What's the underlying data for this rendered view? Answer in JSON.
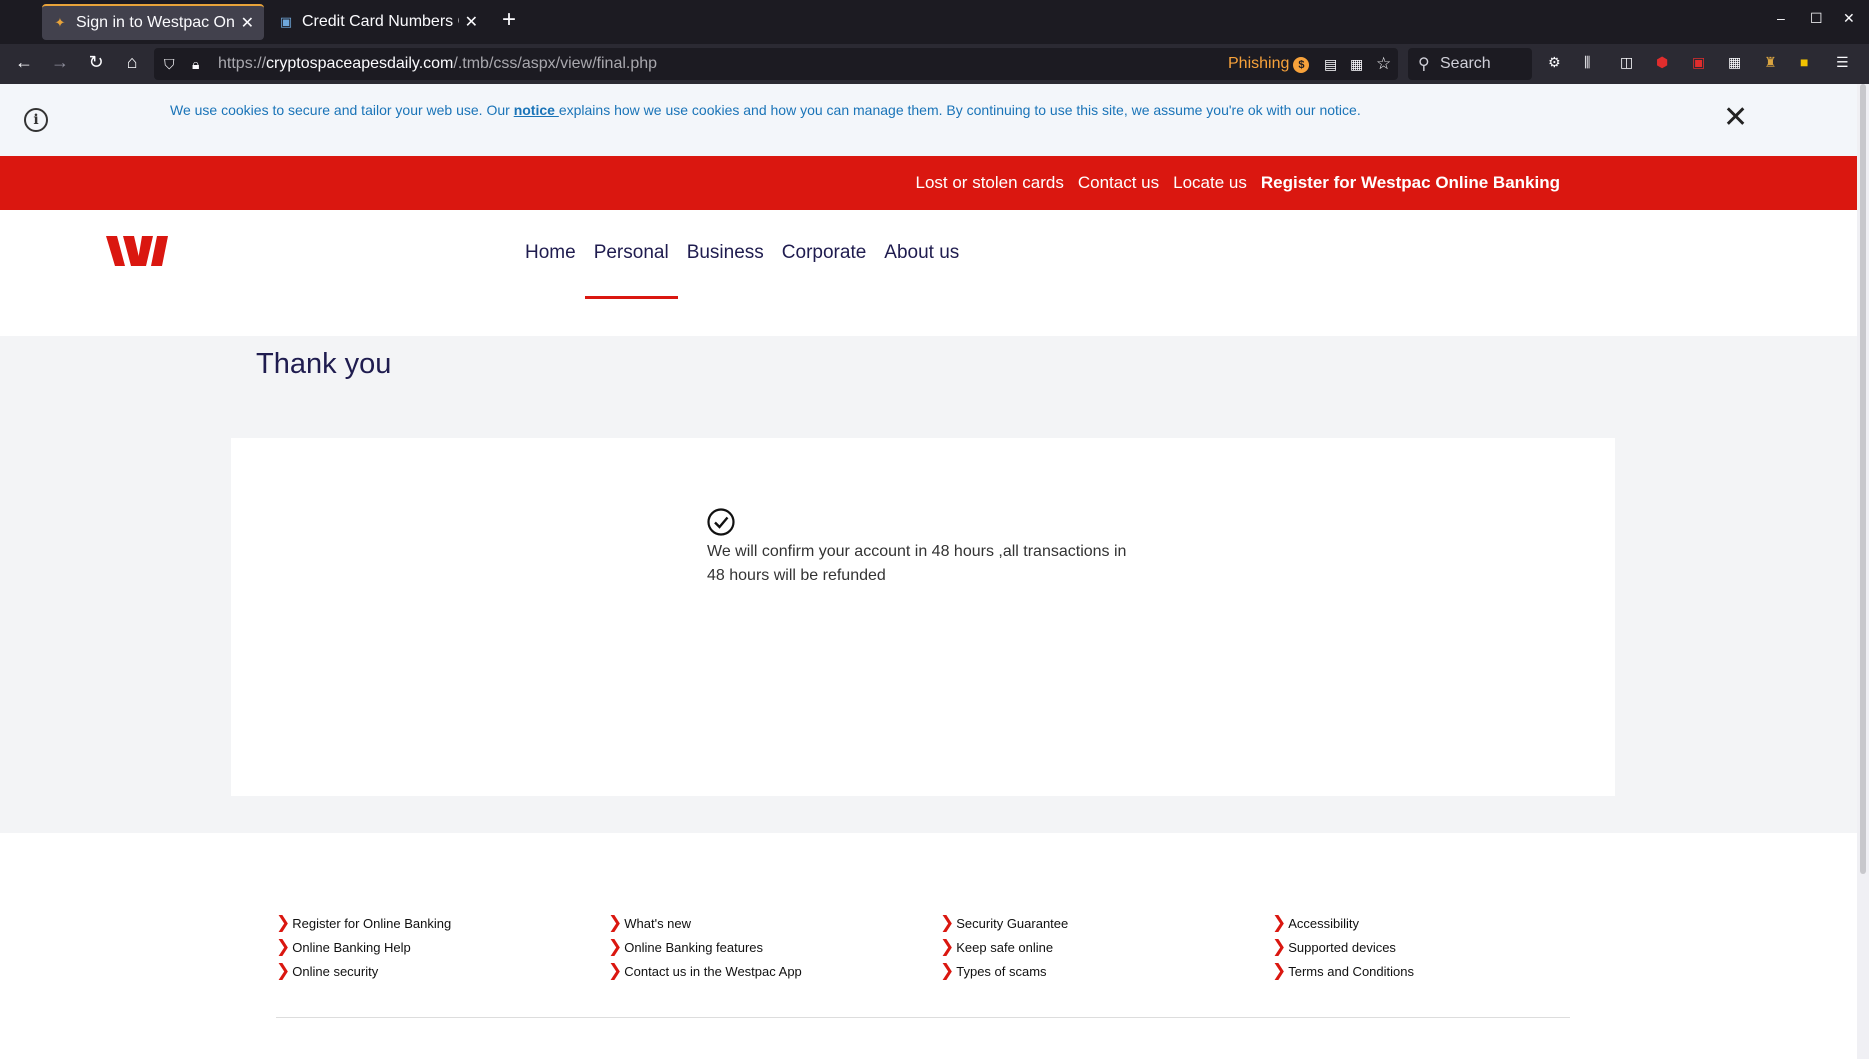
{
  "browser": {
    "tabs": [
      {
        "title": "Sign in to Westpac Online",
        "favicon": "westpac-icon",
        "active": true
      },
      {
        "title": "Credit Card Numbers Gen",
        "favicon": "card-icon",
        "active": false
      }
    ],
    "new_tab": "+",
    "window_controls": {
      "minimize": "–",
      "maximize": "☐",
      "close": "✕"
    },
    "url_prefix": "https://",
    "url_host": "cryptospaceapesdaily.com",
    "url_path": "/.tmb/css/aspx/view/final.php",
    "phishing_label": "Phishing",
    "phishing_count": "$",
    "search_placeholder": "Search"
  },
  "cookie_banner": {
    "before": "We use cookies to secure and tailor your web use. Our ",
    "link": "notice ",
    "after": "explains how we use cookies and how you can manage them. By continuing to use this site, we assume you're ok with our notice.",
    "close": "✕"
  },
  "top_links": [
    "Lost or stolen cards",
    "Contact us",
    "Locate us",
    "Register for Westpac Online Banking"
  ],
  "main_nav": [
    "Home",
    "Personal",
    "Business",
    "Corporate",
    "About us"
  ],
  "page_title": "Thank you",
  "confirmation_message": "We will confirm your account in 48 hours ,all transactions in 48 hours will be refunded",
  "footer_columns": [
    [
      "Register for Online Banking",
      "Online Banking Help",
      "Online security"
    ],
    [
      "What's new",
      "Online Banking features",
      "Contact us in the Westpac App"
    ],
    [
      "Security Guarantee",
      "Keep safe online",
      "Types of scams"
    ],
    [
      "Accessibility",
      "Supported devices",
      "Terms and Conditions"
    ]
  ],
  "colors": {
    "brand_red": "#da1710",
    "link_blue": "#1a74b8",
    "navy": "#1f1c4f"
  }
}
